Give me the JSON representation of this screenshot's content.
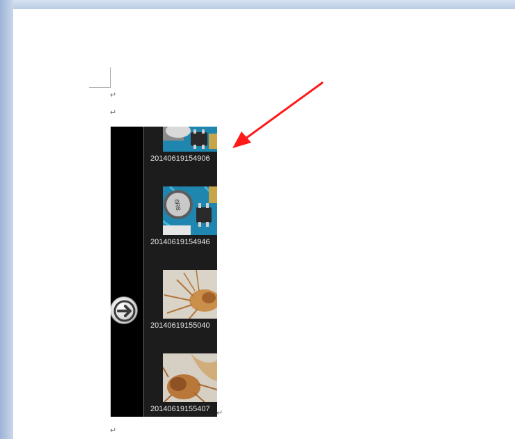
{
  "document": {
    "paragraph_mark": "↵"
  },
  "gallery": {
    "nav_icon": "arrow-right-circle-icon",
    "items": [
      {
        "label": "20140619154906",
        "thumbnail": "circuit-board"
      },
      {
        "label": "20140619154946",
        "thumbnail": "circuit-board"
      },
      {
        "label": "20140619155040",
        "thumbnail": "insect-specimen"
      },
      {
        "label": "20140619155407",
        "thumbnail": "insect-specimen"
      }
    ]
  },
  "annotation": {
    "arrow_color": "#ff1a1a"
  },
  "colors": {
    "frame": "#b9cbe3",
    "gallery_bg": "#1c1c1c"
  }
}
